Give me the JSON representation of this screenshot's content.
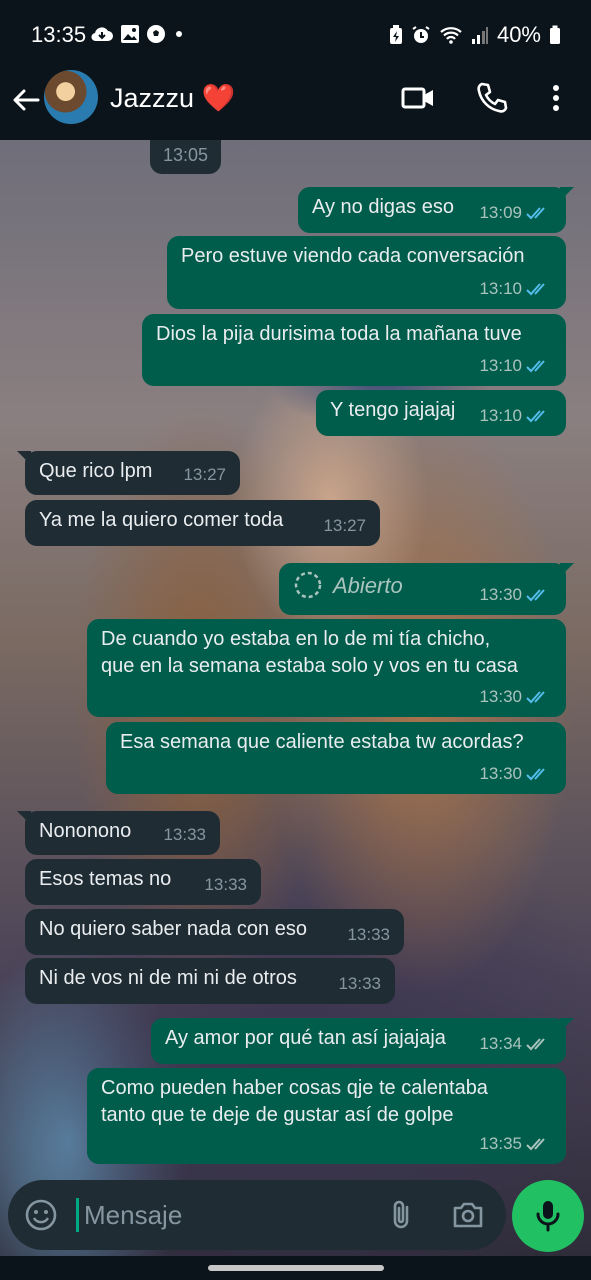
{
  "status_bar": {
    "time": "13:35",
    "left_icons": [
      "cloud-icon",
      "image-icon",
      "soccer-ball-icon",
      "dot-icon"
    ],
    "right_icons": [
      "battery-saver-icon",
      "alarm-icon",
      "wifi-icon",
      "signal-icon",
      "battery-icon"
    ],
    "battery": "40%"
  },
  "header": {
    "contact_name": "Jazzzu",
    "heart": "❤️",
    "icons": [
      "back-arrow-icon",
      "video-call-icon",
      "phone-icon",
      "more-vert-icon"
    ]
  },
  "chat": {
    "top_timestamp": "13:05",
    "messages": [
      {
        "dir": "out",
        "text": "Ay no digas eso",
        "time": "13:09",
        "read": true
      },
      {
        "dir": "out",
        "text": "Pero estuve viendo cada conversación",
        "time": "13:10",
        "read": true
      },
      {
        "dir": "out",
        "text": "Dios la pija durisima toda la mañana tuve",
        "time": "13:10",
        "read": true
      },
      {
        "dir": "out",
        "text": "Y tengo jajajaj",
        "time": "13:10",
        "read": true
      },
      {
        "dir": "in",
        "text": "Que rico lpm",
        "time": "13:27"
      },
      {
        "dir": "in",
        "text": "Ya me la quiero comer toda",
        "time": "13:27"
      },
      {
        "dir": "out",
        "type": "view-once",
        "text": "Abierto",
        "time": "13:30",
        "read": true
      },
      {
        "dir": "out",
        "text_lines": [
          "De cuando yo estaba en lo de mi tía chicho,",
          "que en la semana estaba solo y vos en tu casa"
        ],
        "time": "13:30",
        "read": true
      },
      {
        "dir": "out",
        "text": "Esa semana que caliente estaba tw acordas?",
        "time": "13:30",
        "read": true
      },
      {
        "dir": "in",
        "text": "Nononono",
        "time": "13:33"
      },
      {
        "dir": "in",
        "text": "Esos temas no",
        "time": "13:33"
      },
      {
        "dir": "in",
        "text": "No quiero saber nada con eso",
        "time": "13:33"
      },
      {
        "dir": "in",
        "text": "Ni de vos ni de mi ni de otros",
        "time": "13:33"
      },
      {
        "dir": "out",
        "text": "Ay amor por qué tan así jajajaja",
        "time": "13:34",
        "read": false
      },
      {
        "dir": "out",
        "text_lines": [
          "Como pueden haber cosas qje te calentaba",
          "tanto que te deje de gustar así de golpe"
        ],
        "time": "13:35",
        "read": false
      }
    ]
  },
  "composer": {
    "placeholder": "Mensaje",
    "icons": [
      "emoji-icon",
      "attach-icon",
      "camera-icon",
      "mic-icon"
    ]
  },
  "colors": {
    "outgoing_bubble": "#005c4b",
    "incoming_bubble": "#1f2c34",
    "read_tick": "#53bdeb",
    "delivered_tick": "#a9c3bd",
    "mic_button": "#21c063"
  }
}
